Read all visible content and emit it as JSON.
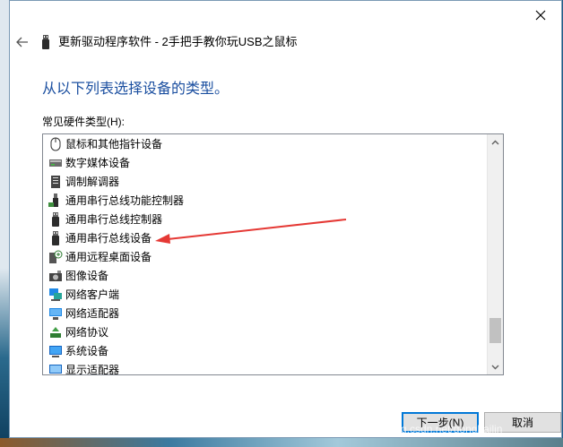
{
  "window": {
    "title": "更新驱动程序软件 - 2手把手教你玩USB之鼠标",
    "close_icon": "close-icon",
    "back_icon": "back-arrow-icon"
  },
  "main": {
    "heading": "从以下列表选择设备的类型。",
    "list_label": "常见硬件类型(H):",
    "items": [
      {
        "label": "鼠标和其他指针设备",
        "icon": "mouse-icon"
      },
      {
        "label": "数字媒体设备",
        "icon": "media-device-icon"
      },
      {
        "label": "调制解调器",
        "icon": "modem-icon"
      },
      {
        "label": "通用串行总线功能控制器",
        "icon": "usb-controller-icon"
      },
      {
        "label": "通用串行总线控制器",
        "icon": "usb-plug-icon"
      },
      {
        "label": "通用串行总线设备",
        "icon": "usb-plug-icon"
      },
      {
        "label": "通用远程桌面设备",
        "icon": "remote-desktop-icon"
      },
      {
        "label": "图像设备",
        "icon": "camera-icon"
      },
      {
        "label": "网络客户端",
        "icon": "network-client-icon"
      },
      {
        "label": "网络适配器",
        "icon": "network-adapter-icon"
      },
      {
        "label": "网络协议",
        "icon": "network-protocol-icon"
      },
      {
        "label": "系统设备",
        "icon": "system-device-icon"
      },
      {
        "label": "显示适配器",
        "icon": "display-adapter-icon"
      }
    ]
  },
  "buttons": {
    "next": "下一步(N)",
    "cancel": "取消"
  },
  "watermark": "https://blog.csdn.net/donghailin"
}
